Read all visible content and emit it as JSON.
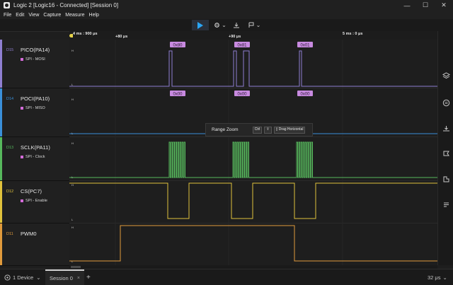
{
  "window": {
    "title": "Logic 2 [Logic16 - Connected] [Session 0]",
    "minimize": "—",
    "maximize": "☐",
    "close": "✕"
  },
  "menu": [
    "File",
    "Edit",
    "View",
    "Capture",
    "Measure",
    "Help"
  ],
  "toolbar": {
    "play": "play",
    "dropdown_arrow": "⌄"
  },
  "ruler": {
    "start": "4 ms : 900 μs",
    "t1": "+80 μs",
    "t2": "+90 μs",
    "end": "5 ms : 0 μs"
  },
  "channels": [
    {
      "num": "D15",
      "name": "PICO(PA14)",
      "sub": "SPI - MOSI",
      "color": "#8f7fd1",
      "h_label": "H",
      "l_label": "L",
      "decodes": [
        "0x80",
        "0x81",
        "0x01"
      ]
    },
    {
      "num": "D14",
      "name": "POCI(PA10)",
      "sub": "SPI - MISO",
      "color": "#3a8fd9",
      "h_label": "H",
      "l_label": "L",
      "decodes": [
        "0x00",
        "0x00",
        "0x00"
      ]
    },
    {
      "num": "D13",
      "name": "SCLK(PA11)",
      "sub": "SPI - Clock",
      "color": "#56b85c",
      "h_label": "H",
      "l_label": "L",
      "decodes": []
    },
    {
      "num": "D12",
      "name": "CS(PC7)",
      "sub": "SPI - Enable",
      "color": "#e0c23c",
      "h_label": "H",
      "l_label": "L",
      "decodes": []
    },
    {
      "num": "D11",
      "name": "PWM0",
      "sub": "",
      "color": "#e09a3c",
      "h_label": "H",
      "l_label": "L",
      "decodes": []
    }
  ],
  "tooltip": {
    "title": "Range Zoom",
    "key1": "Ctrl",
    "key2": "⇧",
    "action": "Drag Horizontal"
  },
  "bottom": {
    "device": "1 Device",
    "session": "Session 0",
    "close": "×",
    "add": "+",
    "sample_rate": "32 μs"
  }
}
